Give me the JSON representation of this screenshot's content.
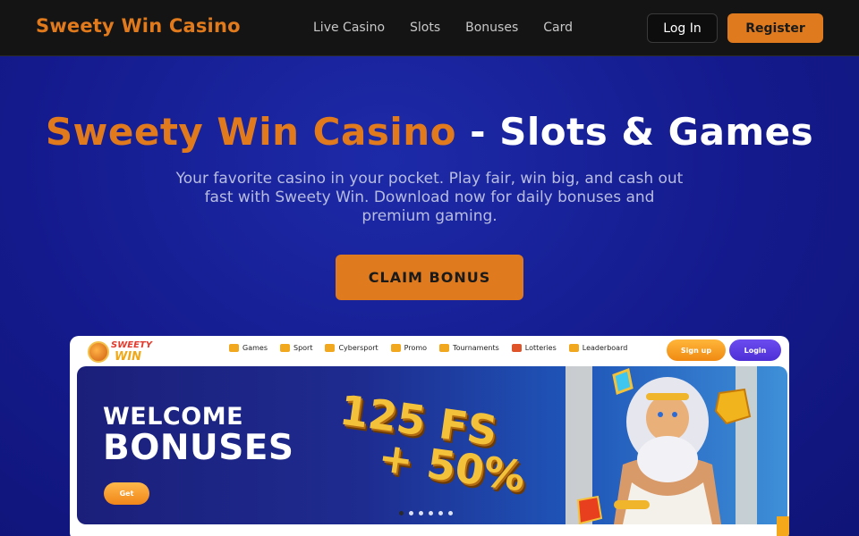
{
  "header": {
    "brand": "Sweety Win Casino",
    "nav": [
      "Live Casino",
      "Slots",
      "Bonuses",
      "Card"
    ],
    "login_label": "Log In",
    "register_label": "Register"
  },
  "hero": {
    "title_accent": "Sweety Win Casino",
    "title_rest": " - Slots & Games",
    "subtitle": "Your favorite casino in your pocket. Play fair, win big, and cash out fast with Sweety Win. Download now for daily bonuses and premium gaming.",
    "cta_label": "CLAIM BONUS"
  },
  "preview": {
    "logo_line1": "SWEETY",
    "logo_line2": "WIN",
    "nav": [
      "Games",
      "Sport",
      "Cybersport",
      "Promo",
      "Tournaments",
      "Lotteries",
      "Leaderboard"
    ],
    "signup_label": "Sign up",
    "login_label": "Login",
    "banner": {
      "line1": "WELCOME",
      "line2": "BONUSES",
      "get_label": "Get",
      "promo_line1": "125 FS",
      "promo_line2": "+ 50%"
    }
  },
  "colors": {
    "accent": "#df7a1e",
    "header_bg": "#141414",
    "hero_bg": "#141a8c",
    "login_purple": "#5a3ae6"
  }
}
